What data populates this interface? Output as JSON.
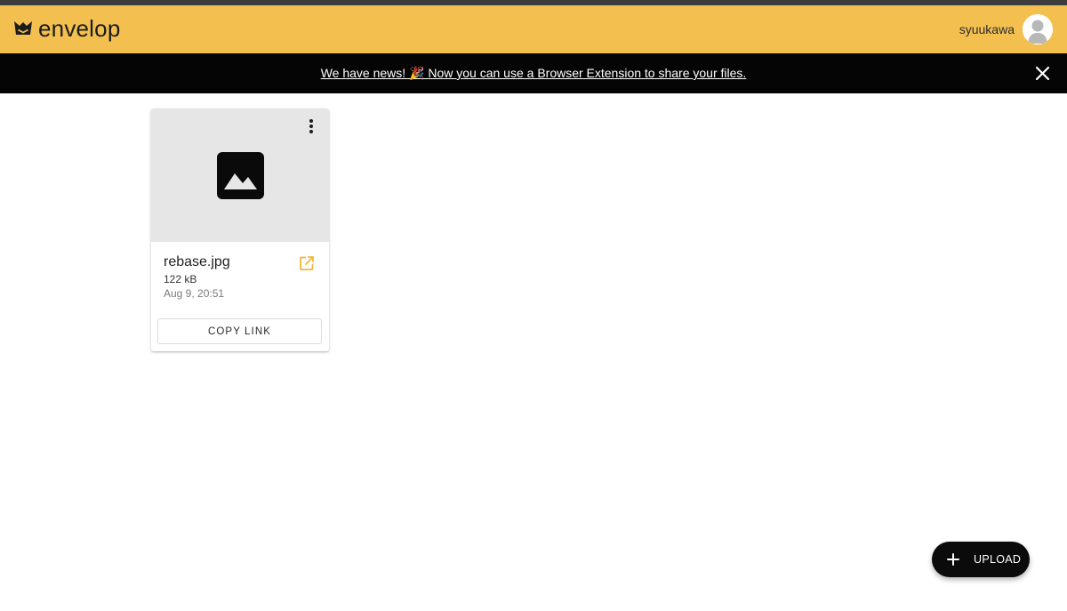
{
  "app": {
    "name": "envelop",
    "brand_color": "#f3c050",
    "accent_color": "#f3b73a"
  },
  "header": {
    "logo_icon": "envelop-crown-icon",
    "username": "syuukawa",
    "avatar_icon": "default-avatar-icon"
  },
  "announcement": {
    "text": "We have news! 🎉  Now you can use a Browser Extension to share your files.",
    "close_icon": "close-icon"
  },
  "files": [
    {
      "name": "rebase.jpg",
      "size": "122 kB",
      "date": "Aug 9, 20:51",
      "preview_icon": "image-icon",
      "menu_icon": "more-vert-icon",
      "open_icon": "open-in-new-icon",
      "copy_label": "COPY LINK"
    }
  ],
  "fab": {
    "icon": "plus-icon",
    "label": "UPLOAD"
  }
}
